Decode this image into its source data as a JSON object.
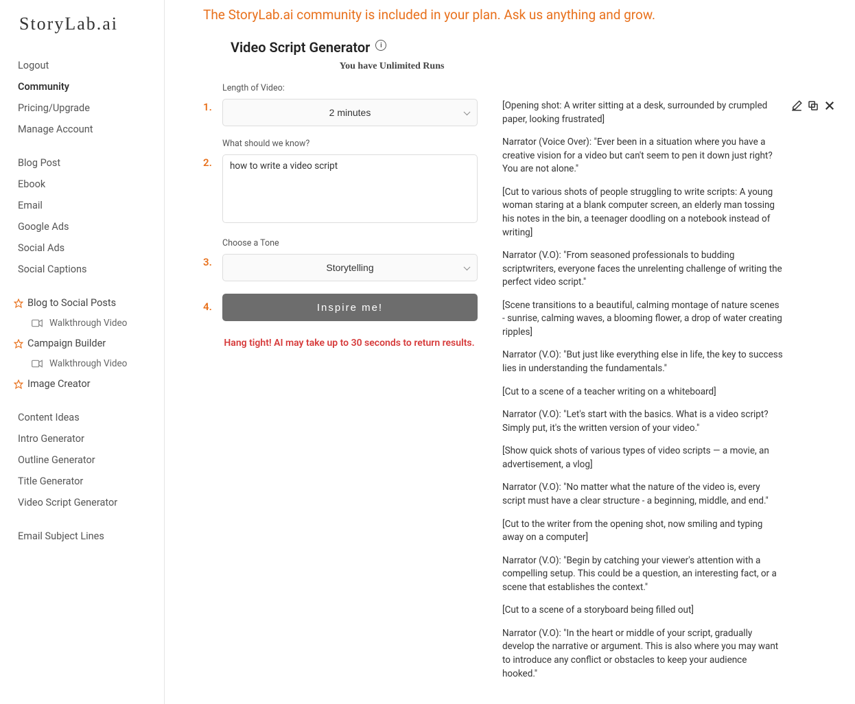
{
  "logo": "StoryLab.ai",
  "banner": "The StoryLab.ai community is included in your plan. Ask us anything and grow.",
  "nav": {
    "top": [
      "Logout",
      "Community",
      "Pricing/Upgrade",
      "Manage Account"
    ],
    "group1": [
      "Blog Post",
      "Ebook",
      "Email",
      "Google Ads",
      "Social Ads",
      "Social Captions"
    ],
    "star1": "Blog to Social Posts",
    "walk1": "Walkthrough Video",
    "star2": "Campaign Builder",
    "walk2": "Walkthrough Video",
    "star3": "Image Creator",
    "group2": [
      "Content Ideas",
      "Intro Generator",
      "Outline Generator",
      "Title Generator",
      "Video Script Generator"
    ],
    "group3": [
      "Email Subject Lines"
    ]
  },
  "page": {
    "title": "Video Script Generator",
    "runs": "You have Unlimited Runs"
  },
  "form": {
    "step1_num": "1.",
    "step1_label": "Length of Video:",
    "step1_value": "2 minutes",
    "step2_num": "2.",
    "step2_label": "What should we know?",
    "step2_value": "how to write a video script",
    "step3_num": "3.",
    "step3_label": "Choose a Tone",
    "step3_value": "Storytelling",
    "step4_num": "4.",
    "inspire": "Inspire me!",
    "hang_tight": "Hang tight! AI may take up to 30 seconds to return results."
  },
  "output": {
    "p1": "[Opening shot: A writer sitting at a desk, surrounded by crumpled paper, looking frustrated]",
    "p2": "Narrator (Voice Over): \"Ever been in a situation where you have a creative vision for a video but can't seem to pen it down just right? You are not alone.\"",
    "p3": "[Cut to various shots of people struggling to write scripts: A young woman staring at a blank computer screen, an elderly man tossing his notes in the bin, a teenager doodling on a notebook instead of writing]",
    "p4": "Narrator (V.O): \"From seasoned professionals to budding scriptwriters, everyone faces the unrelenting challenge of writing the perfect video script.\"",
    "p5": "[Scene transitions to a beautiful, calming montage of nature scenes - sunrise, calming waves, a blooming flower, a drop of water creating ripples]",
    "p6": "Narrator (V.O): \"But just like everything else in life, the key to success lies in understanding the fundamentals.\"",
    "p7": "[Cut to a scene of a teacher writing on a whiteboard]",
    "p8": "Narrator (V.O): \"Let's start with the basics. What is a video script? Simply put, it's the written version of your video.\"",
    "p9": "[Show quick shots of various types of video scripts — a movie, an advertisement, a vlog]",
    "p10": "Narrator (V.O): \"No matter what the nature of the video is, every script must have a clear structure - a beginning, middle, and end.\"",
    "p11": "[Cut to the writer from the opening shot, now smiling and typing away on a computer]",
    "p12": "Narrator (V.O): \"Begin by catching your viewer's attention with a compelling setup. This could be a question, an interesting fact, or a scene that establishes the context.\"",
    "p13": "[Cut to a scene of a storyboard being filled out]",
    "p14": "Narrator (V.O): \"In the heart or middle of your script, gradually develop the narrative or argument. This is also where you may want to introduce any conflict or obstacles to keep your audience hooked.\""
  }
}
